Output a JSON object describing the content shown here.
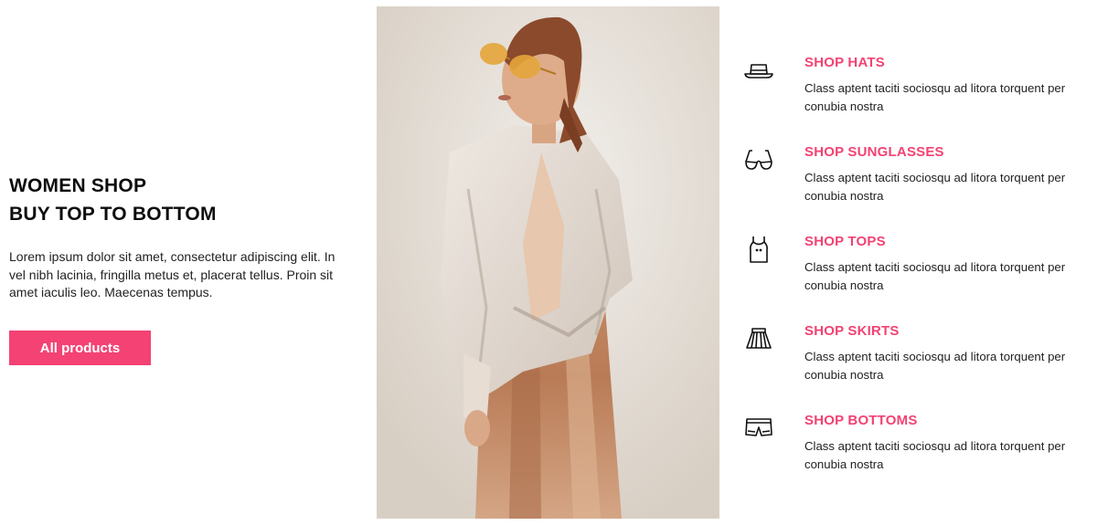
{
  "hero": {
    "title_line1": "WOMEN SHOP",
    "title_line2": "BUY TOP TO BOTTOM",
    "text": "Lorem ipsum dolor sit amet, consectetur adipiscing elit. In vel nibh lacinia, fringilla metus et, placerat tellus. Proin sit amet iaculis leo. Maecenas tempus.",
    "button_label": "All products"
  },
  "colors": {
    "accent": "#f34273",
    "text": "#111111"
  },
  "features": [
    {
      "icon": "hat-icon",
      "title": "SHOP HATS",
      "text": "Class aptent taciti sociosqu ad litora torquent per conubia nostra"
    },
    {
      "icon": "sunglasses-icon",
      "title": "SHOP SUNGLASSES",
      "text": "Class aptent taciti sociosqu ad litora torquent per conubia nostra"
    },
    {
      "icon": "tank-top-icon",
      "title": "SHOP TOPS",
      "text": "Class aptent taciti sociosqu ad litora torquent per conubia nostra"
    },
    {
      "icon": "skirt-icon",
      "title": "SHOP SKIRTS",
      "text": "Class aptent taciti sociosqu ad litora torquent per conubia nostra"
    },
    {
      "icon": "shorts-icon",
      "title": "SHOP BOTTOMS",
      "text": "Class aptent taciti sociosqu ad litora torquent per conubia nostra"
    }
  ]
}
